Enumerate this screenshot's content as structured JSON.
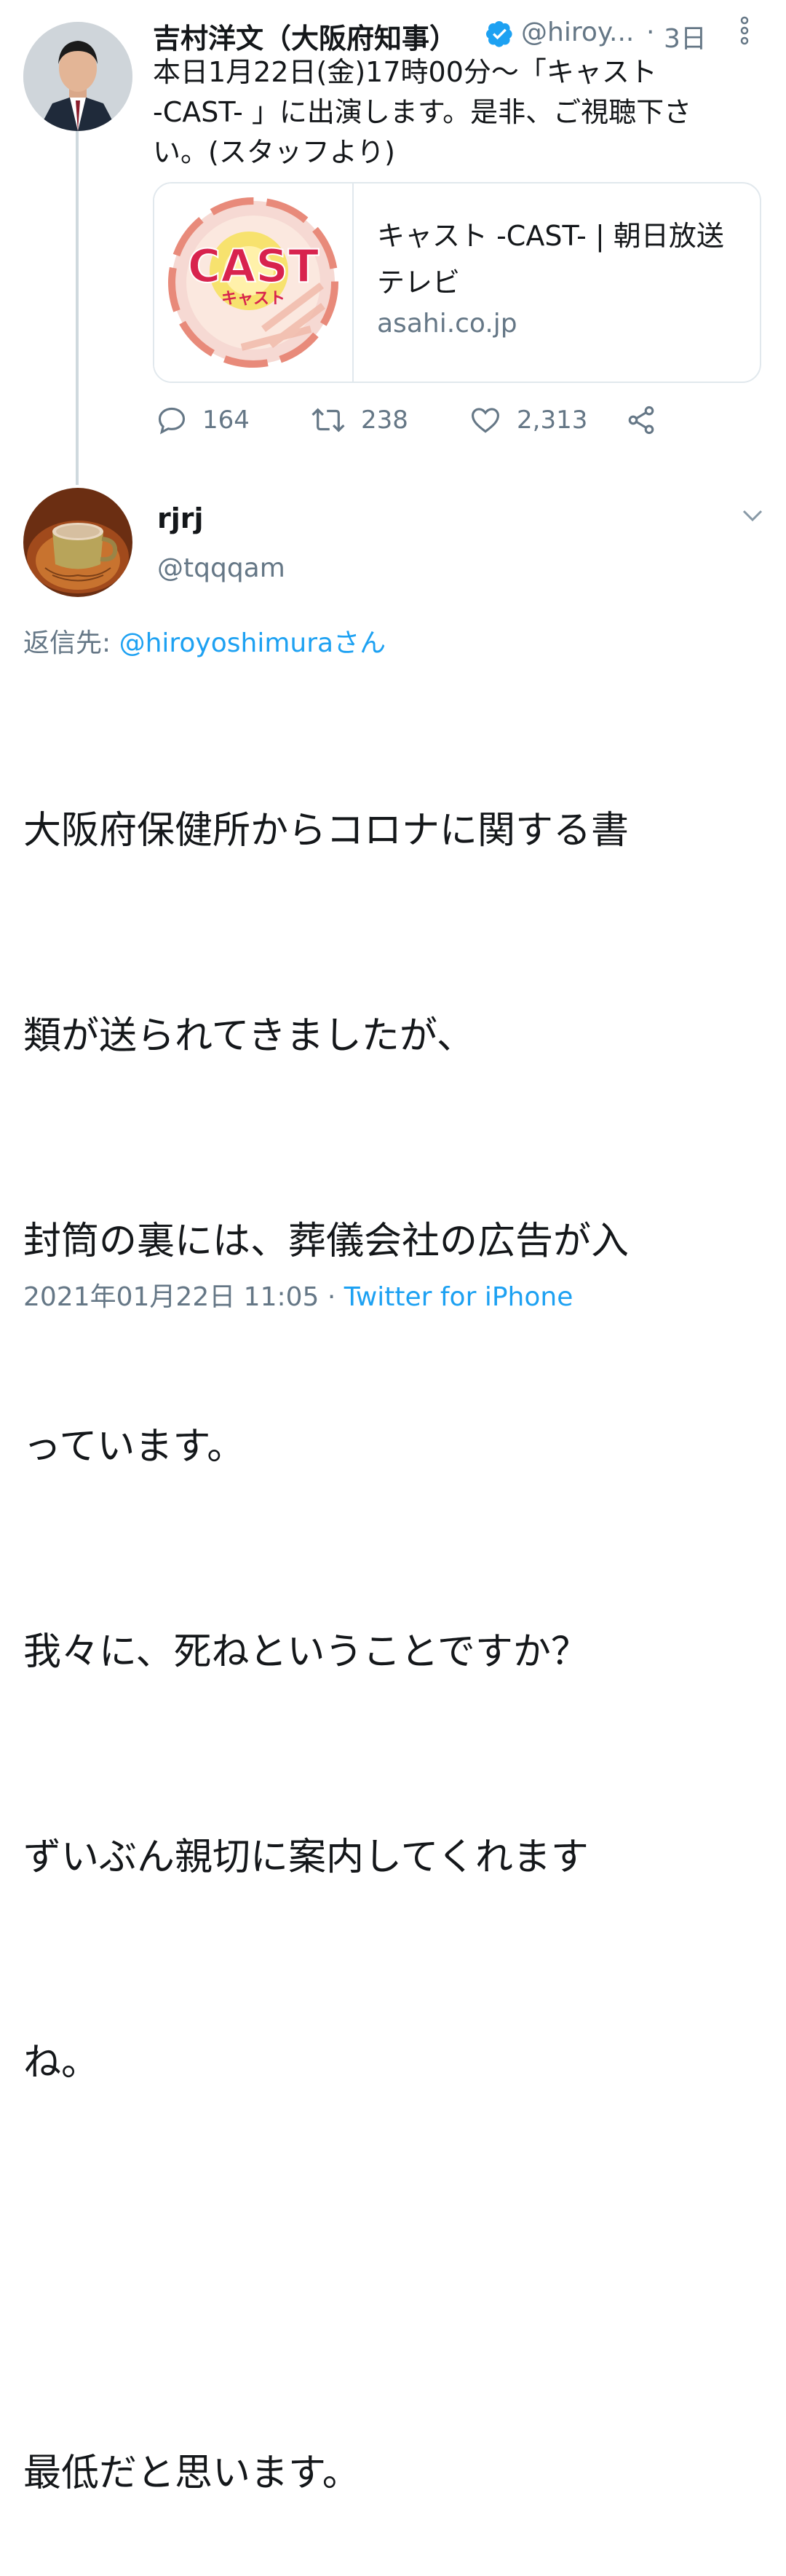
{
  "original_tweet": {
    "display_name": "吉村洋文（大阪府知事）",
    "handle": "@hiroy...",
    "time_sep": "·",
    "time": "3日",
    "text": "本日1月22日(金)17時00分〜「キャスト -CAST- 」に出演します。是非、ご視聴下さい。(スタッフより)",
    "text_lines": [
      "本日1月22日(金)17時00分〜「キャスト",
      "-CAST- 」に出演します。是非、ご視聴下さ",
      "い。(スタッフより)"
    ],
    "card": {
      "logo_text": "CAST",
      "logo_subtext": "キャスト",
      "title": "キャスト -CAST- | 朝日放送テレビ",
      "title_lines": [
        "キャスト -CAST- | 朝日放送",
        "テレビ"
      ],
      "domain": "asahi.co.jp"
    },
    "actions": {
      "replies": "164",
      "retweets": "238",
      "likes": "2,313"
    }
  },
  "reply_tweet": {
    "display_name": "rjrj",
    "handle": "@tqqqam",
    "replying_to_label": "返信先: ",
    "replying_to_handle": "@hiroyoshimura",
    "replying_to_suffix": "さん",
    "text_lines": [
      "大阪府保健所からコロナに関する書",
      "類が送られてきましたが、",
      "封筒の裏には、葬儀会社の広告が入",
      "っています。",
      "我々に、死ねということですか？",
      "ずいぶん親切に案内してくれます",
      "ね。",
      "",
      "最低だと思います。"
    ],
    "timestamp": "2021年01月22日 11:05",
    "meta_sep": " · ",
    "source": "Twitter for iPhone"
  },
  "colors": {
    "verified": "#1da1f2",
    "link": "#1da1f2",
    "muted": "#657786",
    "thread_line": "#cfd9de"
  }
}
